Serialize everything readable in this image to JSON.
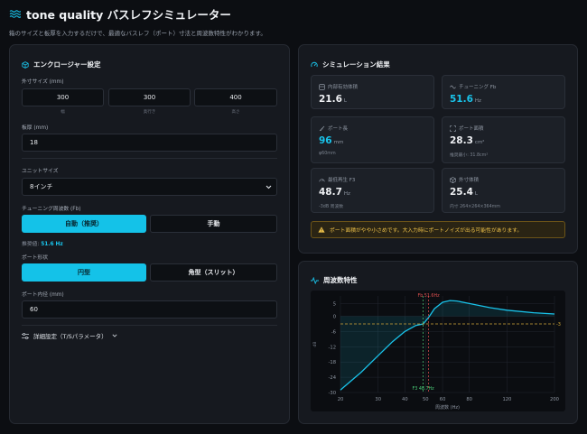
{
  "header": {
    "title": "tone quality バスレフシミュレーター",
    "subtitle": "箱のサイズと板厚を入力するだけで、最適なバスレフ（ポート）寸法と周波数特性がわかります。"
  },
  "enclosure": {
    "title": "エンクロージャー設定",
    "outer_label": "外寸サイズ (mm)",
    "width": "300",
    "depth": "300",
    "height": "400",
    "width_label": "幅",
    "depth_label": "奥行き",
    "height_label": "高さ",
    "thickness_label": "板厚 (mm)",
    "thickness": "18",
    "unit_label": "ユニットサイズ",
    "unit_value": "8インチ",
    "tuning_label": "チューニング周波数 (Fb)",
    "tuning_auto": "自動（推奨）",
    "tuning_manual": "手動",
    "recommend_prefix": "推奨値:",
    "recommend_value": "51.6 Hz",
    "port_shape_label": "ポート形状",
    "port_round": "円型",
    "port_slot": "角型（スリット）",
    "port_diameter_label": "ポート内径 (mm)",
    "port_diameter": "60",
    "advanced_label": "詳細設定（T/Sパラメータ）"
  },
  "results": {
    "title": "シミュレーション結果",
    "cards": [
      {
        "label": "内部有効体積",
        "value": "21.6",
        "unit": "L",
        "sub": "",
        "icon": "box-icon"
      },
      {
        "label": "チューニング Fb",
        "value": "51.6",
        "unit": "Hz",
        "sub": "",
        "icon": "wave-icon"
      },
      {
        "label": "ポート長",
        "value": "96",
        "unit": "mm",
        "sub": "φ60mm",
        "icon": "ruler-icon"
      },
      {
        "label": "ポート面積",
        "value": "28.3",
        "unit": "cm²",
        "sub": "推奨最小: 31.8cm²",
        "icon": "area-icon"
      },
      {
        "label": "最低再生 F3",
        "value": "48.7",
        "unit": "Hz",
        "sub": "-3dB 周波数",
        "icon": "gauge-icon"
      },
      {
        "label": "外寸体積",
        "value": "25.4",
        "unit": "L",
        "sub": "内寸 264×264×364mm",
        "icon": "cube-icon"
      }
    ],
    "warning": "ポート面積がやや小さめです。大入力時にポートノイズが出る可能性があります。"
  },
  "freq": {
    "title": "周波数特性",
    "xlabel": "周波数 (Hz)",
    "ylabel": "dB"
  },
  "chart_data": {
    "type": "line",
    "xlabel": "周波数 (Hz)",
    "ylabel": "dB",
    "xlim": [
      20,
      200
    ],
    "ylim": [
      -30,
      8
    ],
    "xticks": [
      20,
      30,
      40,
      50,
      60,
      80,
      120,
      200
    ],
    "yticks": [
      5,
      0,
      -6,
      -12,
      -18,
      -24,
      -30
    ],
    "x": [
      20,
      25,
      30,
      35,
      40,
      45,
      48.7,
      51.6,
      55,
      60,
      65,
      70,
      80,
      100,
      120,
      160,
      200
    ],
    "y": [
      -29,
      -22,
      -15.5,
      -10,
      -6,
      -3.6,
      -3,
      -0.5,
      3,
      5.5,
      6.2,
      6.0,
      5.0,
      3.4,
      2.4,
      1.4,
      0.9
    ],
    "markers": [
      {
        "label": "Fb 51.6Hz",
        "x": 51.6,
        "color": "#e05050"
      },
      {
        "label": "F3 48.7Hz",
        "x": 48.7,
        "color": "#4cd07a"
      }
    ],
    "reference": {
      "label": "-3",
      "y": -3,
      "color": "#d4a838"
    },
    "line_color": "#19c3ea"
  }
}
